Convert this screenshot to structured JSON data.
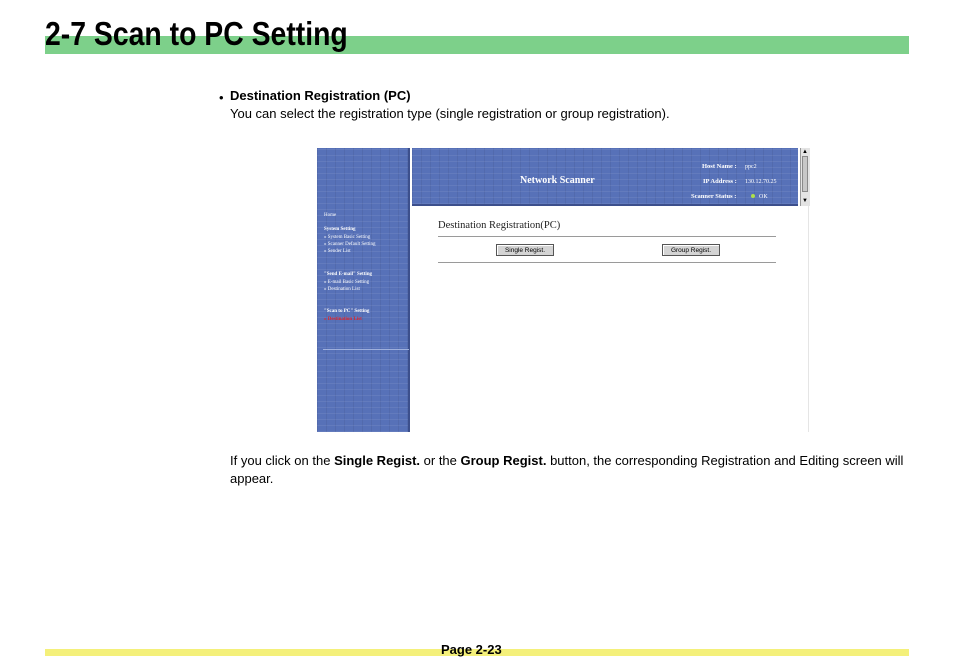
{
  "document": {
    "title": "2-7  Scan to PC Setting",
    "section": {
      "bullet": "•",
      "heading": "Destination Registration (PC)",
      "description": "You can select the registration type (single registration or group registration)."
    },
    "paragraph": {
      "part1": "If you click on the ",
      "bold1": "Single Regist.",
      "part2": " or the ",
      "bold2": "Group Regist.",
      "part3": " button, the corresponding Registration and Editing screen will appear."
    },
    "footer": {
      "page": "Page 2-23"
    }
  },
  "screenshot": {
    "header": {
      "title": "Network Scanner",
      "host_label": "Host Name :",
      "host_value": "ppc2",
      "ip_label": "IP Address :",
      "ip_value": "130.12.70.25",
      "status_label": "Scanner Status :",
      "status_value": "OK"
    },
    "sidebar": {
      "home": "Home",
      "group1": {
        "title": "System Setting",
        "items": [
          "System Basic Setting",
          "Scanner Default Setting",
          "Sender List"
        ]
      },
      "group2": {
        "title": "\"Send E-mail\" Setting",
        "items": [
          "E-mail Basic Setting",
          "Destination List"
        ]
      },
      "group3": {
        "title": "\"Scan to PC\" Setting",
        "items": [
          "Destination List"
        ]
      },
      "active_color": "#e0242a"
    },
    "content": {
      "title": "Destination Registration(PC)",
      "single_button": "Single Regist.",
      "group_button": "Group Regist."
    }
  },
  "colors": {
    "title_bar": "#7dd08a",
    "footer_bar": "#f4f07a",
    "panel_blue": "#5771b8"
  }
}
